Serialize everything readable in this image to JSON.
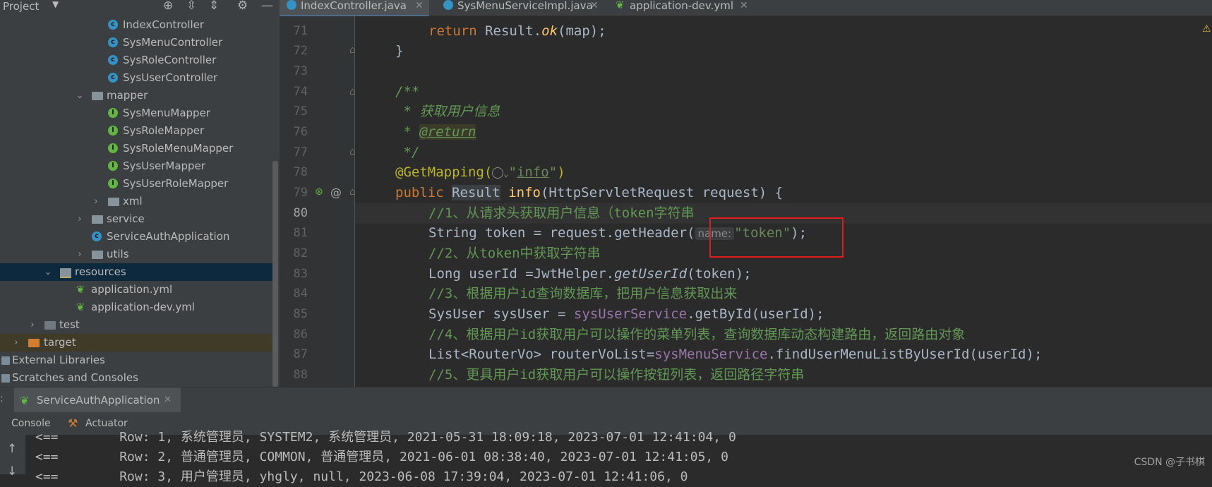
{
  "project_panel": {
    "title": "Project",
    "tree": [
      {
        "label": "IndexController",
        "icon": "class-icon"
      },
      {
        "label": "SysMenuController",
        "icon": "class-icon"
      },
      {
        "label": "SysRoleController",
        "icon": "class-icon"
      },
      {
        "label": "SysUserController",
        "icon": "class-icon"
      },
      {
        "label": "mapper",
        "icon": "folder-icon"
      },
      {
        "label": "SysMenuMapper",
        "icon": "interface-icon"
      },
      {
        "label": "SysRoleMapper",
        "icon": "interface-icon"
      },
      {
        "label": "SysRoleMenuMapper",
        "icon": "interface-icon"
      },
      {
        "label": "SysUserMapper",
        "icon": "interface-icon"
      },
      {
        "label": "SysUserRoleMapper",
        "icon": "interface-icon"
      },
      {
        "label": "xml",
        "icon": "folder-icon"
      },
      {
        "label": "service",
        "icon": "folder-icon"
      },
      {
        "label": "ServiceAuthApplication",
        "icon": "spring-boot-app-icon"
      },
      {
        "label": "utils",
        "icon": "folder-icon"
      },
      {
        "label": "resources",
        "icon": "resources-folder-icon"
      },
      {
        "label": "application.yml",
        "icon": "spring-config-icon"
      },
      {
        "label": "application-dev.yml",
        "icon": "spring-config-icon"
      },
      {
        "label": "test",
        "icon": "folder-icon"
      },
      {
        "label": "target",
        "icon": "target-folder-icon"
      },
      {
        "label": "External Libraries",
        "icon": "library-icon"
      },
      {
        "label": "Scratches and Consoles",
        "icon": "scratches-icon"
      }
    ]
  },
  "tabs": [
    {
      "label": "IndexController.java",
      "active": true
    },
    {
      "label": "SysMenuServiceImpl.java",
      "active": false
    },
    {
      "label": "application-dev.yml",
      "active": false
    }
  ],
  "editor": {
    "line_numbers": [
      "71",
      "72",
      "73",
      "74",
      "75",
      "76",
      "77",
      "78",
      "79",
      "80",
      "81",
      "82",
      "83",
      "84",
      "85",
      "86",
      "87",
      "88"
    ],
    "current_line": "80",
    "code": {
      "l71_kw": "return",
      "l71_a": " Result.",
      "l71_fn": "ok",
      "l71_b": "(map);",
      "l72": "}",
      "l74": "/**",
      "l75": " * 获取用户信息",
      "l76_a": " * ",
      "l76_tag": "@return",
      "l77": " */",
      "l78_ann": "@GetMapping(",
      "l78_q1": "\"",
      "l78_str": "info",
      "l78_q2": "\"",
      "l78_close": ")",
      "l79_kw": "public",
      "l79_type": "Result",
      "l79_fn": "info",
      "l79_rest": "(HttpServletRequest request) {",
      "l80": "//1、从请求头获取用户信息（token字符串",
      "l81_a": "String token = request.getHeader(",
      "l81_hint": "name:",
      "l81_str": "\"token\"",
      "l81_b": ");",
      "l82": "//2、从token中获取字符串",
      "l83_a": "Long userId =JwtHelper.",
      "l83_fn": "getUserId",
      "l83_b": "(token);",
      "l84": "//3、根据用户id查询数据库，把用户信息获取出来",
      "l85_a": "SysUser sysUser = ",
      "l85_fld": "sysUserService",
      "l85_b": ".getById(userId);",
      "l86": "//4、根据用户id获取用户可以操作的菜单列表，查询数据库动态构建路由，返回路由对象",
      "l87_a": "List<RouterVo> routerVoList=",
      "l87_fld": "sysMenuService",
      "l87_b": ".findUserMenuListByUserId(userId);",
      "l88": "//5、更具用户id获取用户可以操作按钮列表，返回路径字符串"
    }
  },
  "run_window": {
    "config_tab": "ServiceAuthApplication",
    "tabs": [
      "Console",
      "Actuator"
    ],
    "console_lines": [
      {
        "prefix": "<==",
        "text": "Row: 1, 系统管理员, SYSTEM2, 系统管理员, 2021-05-31 18:09:18, 2023-07-01 12:41:04, 0"
      },
      {
        "prefix": "<==",
        "text": "Row: 2, 普通管理员, COMMON, 普通管理员, 2021-06-01 08:38:40, 2023-07-01 12:41:05, 0"
      },
      {
        "prefix": "<==",
        "text": "Row: 3, 用户管理员, yhgly, null, 2023-06-08 17:39:04, 2023-07-01 12:41:06, 0"
      }
    ]
  },
  "watermark": "CSDN @子书棋"
}
